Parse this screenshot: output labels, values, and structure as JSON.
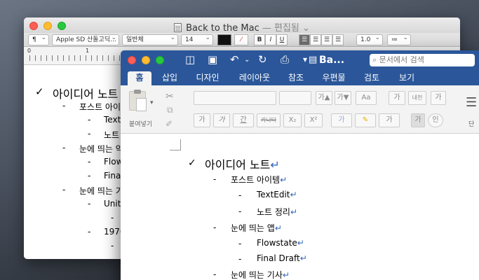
{
  "textedit": {
    "title": "Back to the Mac",
    "title_sep": " — ",
    "status": "편집됨",
    "toolbar": {
      "paragraph": "¶",
      "font": "Apple SD 산돌고딕...",
      "style": "일반체",
      "size": "14",
      "bold": "B",
      "italic": "I",
      "underline": "U",
      "spacing": "1.0",
      "list": "≔"
    },
    "ruler_labels": [
      "0",
      "1"
    ],
    "lines": [
      {
        "bullet": "✓",
        "text": "아이디어 노트"
      },
      {
        "bullet": "-",
        "text": "포스트 아이"
      },
      {
        "bullet": "-",
        "text": "Text"
      },
      {
        "bullet": "-",
        "text": "노트"
      },
      {
        "bullet": "-",
        "text": "눈에 띄는 약"
      },
      {
        "bullet": "-",
        "text": "Flow"
      },
      {
        "bullet": "-",
        "text": "Fina"
      },
      {
        "bullet": "-",
        "text": "눈에 띄는 기"
      },
      {
        "bullet": "-",
        "text": "Unit"
      },
      {
        "bullet": "-",
        "text": ""
      },
      {
        "bullet": "-",
        "text": "1970"
      },
      {
        "bullet": "-",
        "text": ""
      }
    ]
  },
  "word": {
    "title": "Ba...",
    "search_placeholder": "문서에서 검색",
    "tabs": [
      "홈",
      "삽입",
      "디자인",
      "레이아웃",
      "참조",
      "우편물",
      "검토",
      "보기"
    ],
    "active_tab": "홈",
    "ribbon": {
      "paste_label": "붙여넣기",
      "grow": "가▲",
      "shrink": "가▼",
      "case": "Aa",
      "clear": "가",
      "phonetic": "내천",
      "border": "가",
      "bold": "가",
      "italic": "가",
      "underline": "간",
      "strike": "카나타",
      "subscript": "X₂",
      "superscript": "X²",
      "effects": "가",
      "highlight": "✎",
      "fontcolor": "가",
      "shade": "가",
      "enclose": "인",
      "right_label": "단"
    },
    "lines": [
      {
        "bullet": "✓",
        "text": "아이디어 노트",
        "ret": "↵"
      },
      {
        "bullet": "-",
        "text": "포스트 아이템",
        "ret": "↵"
      },
      {
        "bullet": "-",
        "text": "TextEdit",
        "ret": "↵"
      },
      {
        "bullet": "-",
        "text": "노트 정리",
        "ret": "↵"
      },
      {
        "bullet": "-",
        "text": "눈에 띄는 앱",
        "ret": "↵"
      },
      {
        "bullet": "-",
        "text": "Flowstate",
        "ret": "↵"
      },
      {
        "bullet": "-",
        "text": "Final Draft",
        "ret": "↵"
      },
      {
        "bullet": "-",
        "text": "눈에 띄는 기사",
        "ret": "↵"
      }
    ]
  }
}
